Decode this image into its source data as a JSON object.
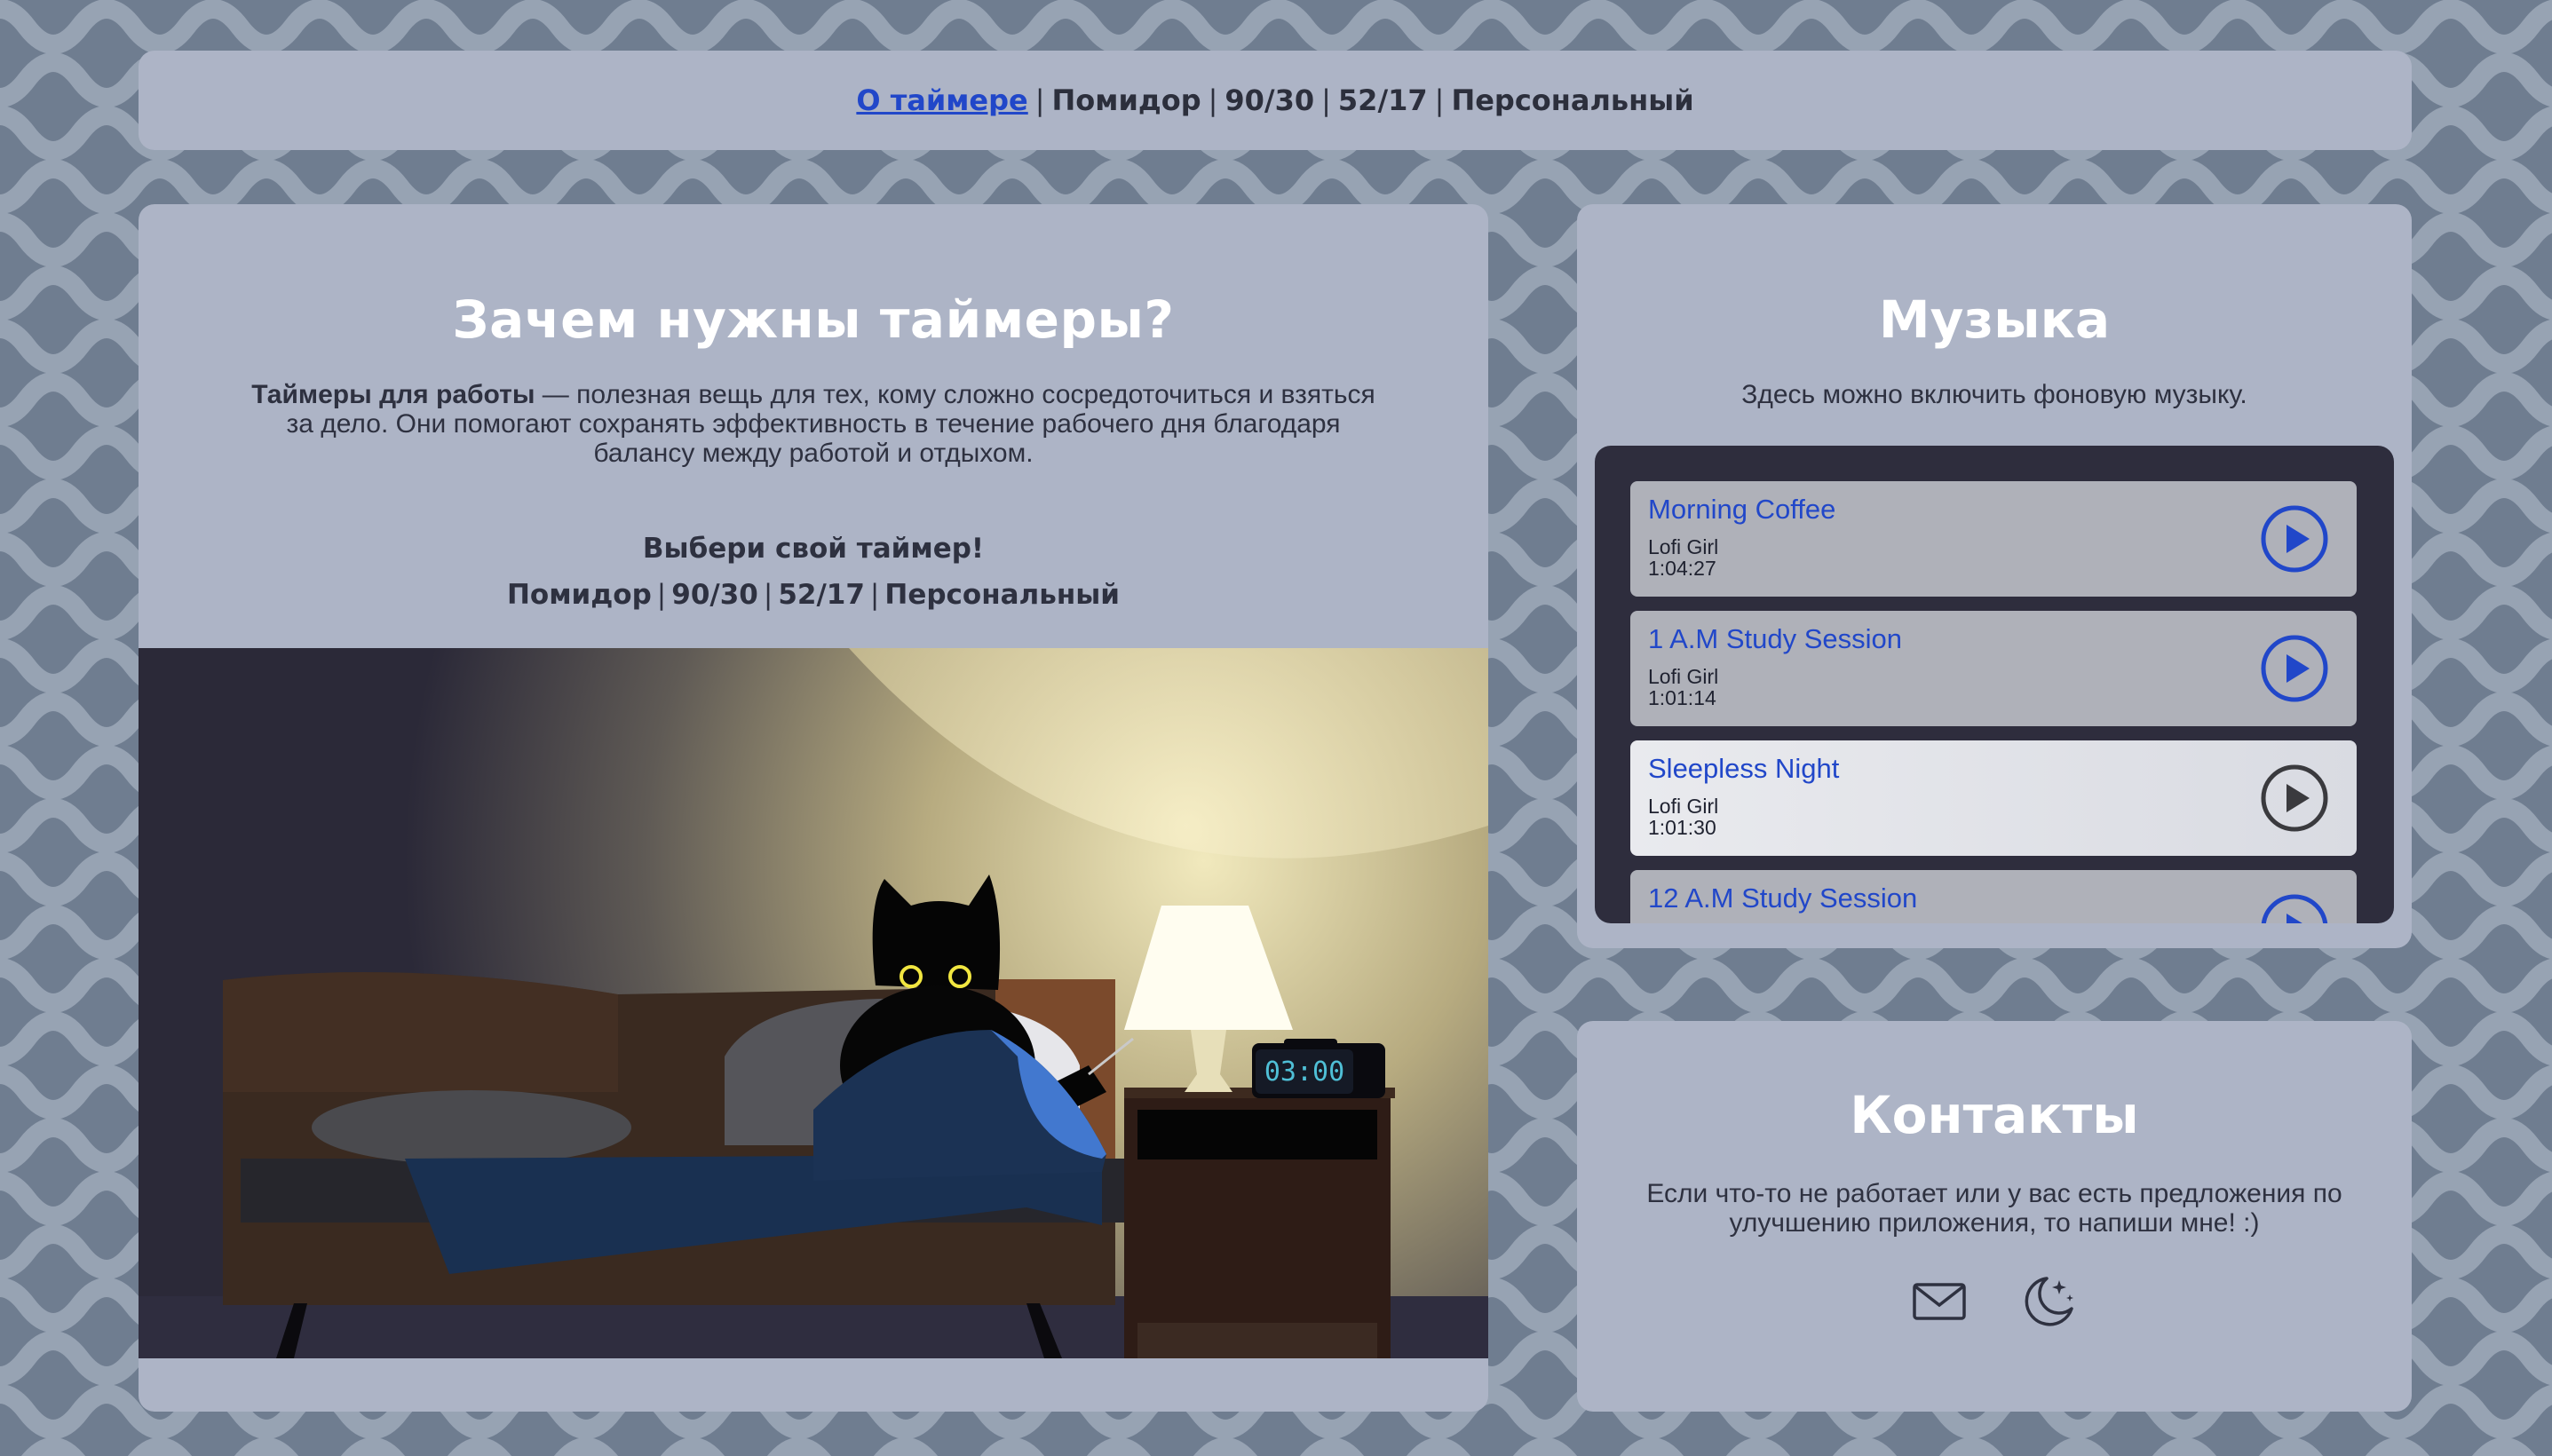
{
  "nav": {
    "about_link": "О таймере",
    "items": [
      "Помидор",
      "90/30",
      "52/17",
      "Персональный"
    ]
  },
  "about": {
    "title": "Зачем нужны таймеры?",
    "desc_bold": "Таймеры для работы",
    "desc_rest": " — полезная вещь для тех, кому сложно сосредоточиться и взяться за дело. Они помогают сохранять эффективность в течение рабочего дня благодаря балансу между работой и отдыхом.",
    "choose": "Выбери свой таймер!",
    "timers": [
      "Помидор",
      "90/30",
      "52/17",
      "Персональный"
    ],
    "clock_time": "03:00"
  },
  "music": {
    "title": "Музыка",
    "subtitle": "Здесь можно включить фоновую музыку.",
    "tracks": [
      {
        "title": "Morning Coffee",
        "artist": "Lofi Girl",
        "duration": "1:04:27"
      },
      {
        "title": "1 A.M Study Session",
        "artist": "Lofi Girl",
        "duration": "1:01:14"
      },
      {
        "title": "Sleepless Night",
        "artist": "Lofi Girl",
        "duration": "1:01:30"
      },
      {
        "title": "12 A.M Study Session",
        "artist": "",
        "duration": ""
      }
    ]
  },
  "contacts": {
    "title": "Контакты",
    "subtitle": "Если что-то не работает или у вас есть предложения по улучшению приложения, то напиши мне! :)",
    "icons": [
      "mail-icon",
      "moon-stars-icon"
    ]
  },
  "colors": {
    "background": "#6f7d90",
    "panel": "#adb4c6",
    "link": "#2147c9",
    "playlist_bg": "#2e2d3d"
  }
}
